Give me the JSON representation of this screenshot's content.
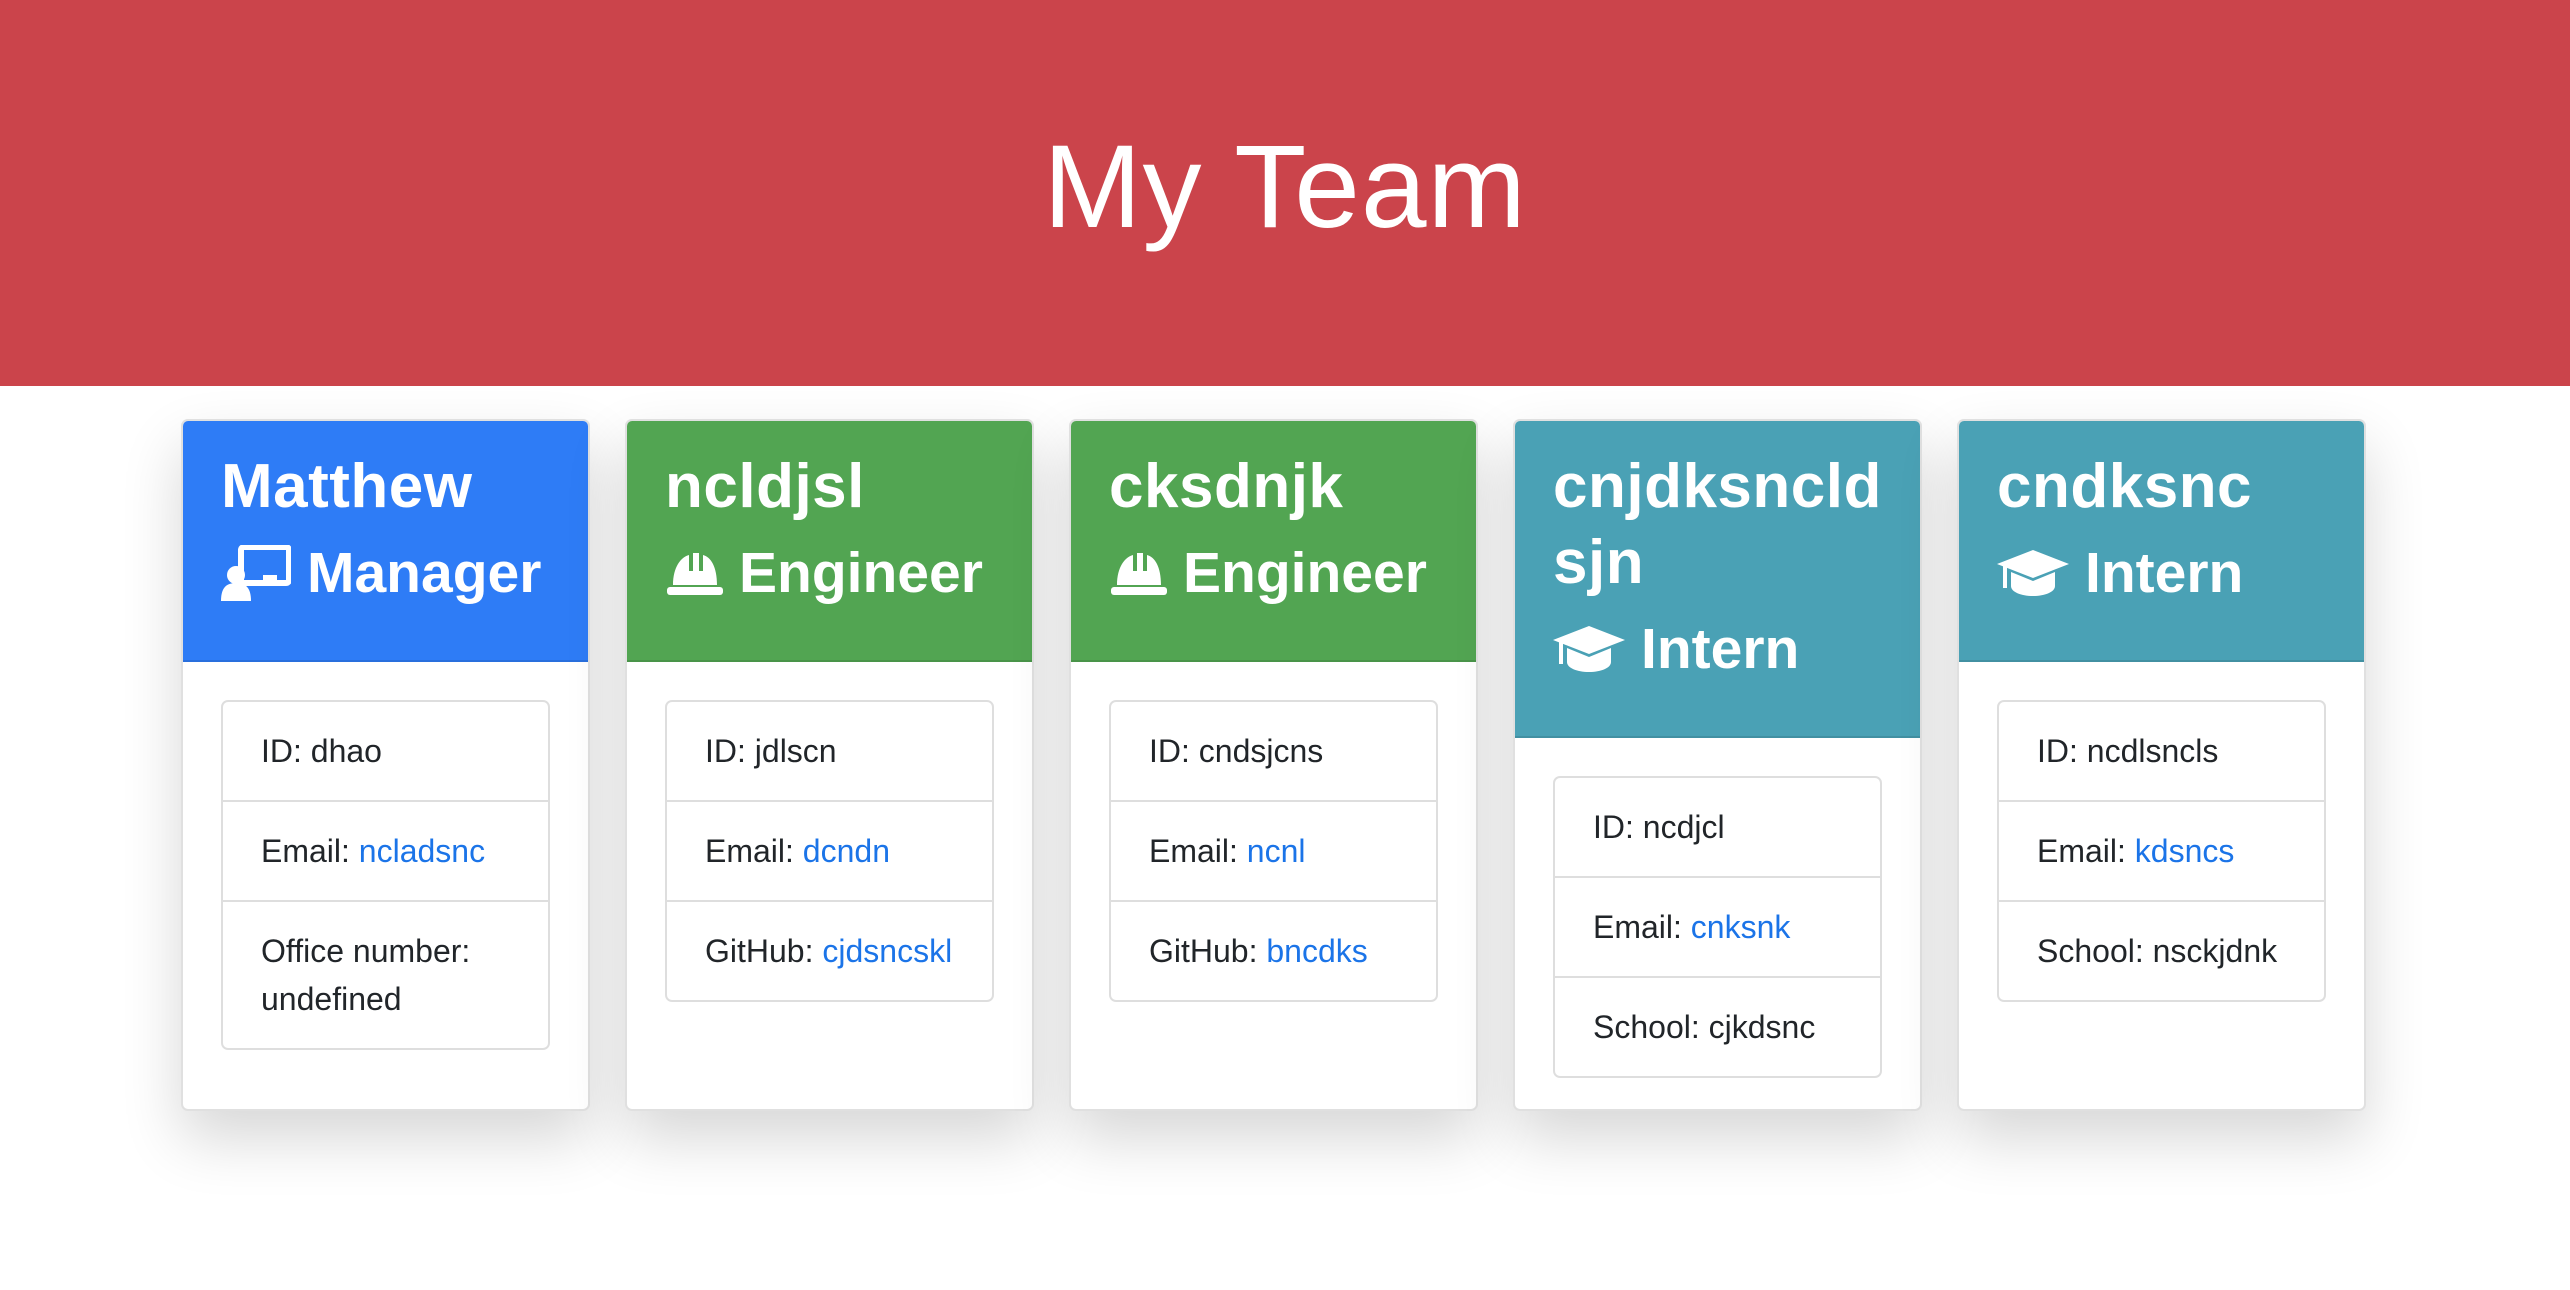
{
  "header": {
    "title": "My Team",
    "background": "#cb444b"
  },
  "employees": [
    {
      "name": "Matthew",
      "role": "Manager",
      "icon": "manager-icon",
      "color": "#2e7cf6",
      "id_label": "ID: ",
      "id": "dhao",
      "email_label": "Email: ",
      "email": "ncladsnc",
      "extra_label": "Office number: ",
      "extra_value": "undefined"
    },
    {
      "name": "ncldjsl",
      "role": "Engineer",
      "icon": "hard-hat-icon",
      "color": "#52a552",
      "id_label": "ID: ",
      "id": "jdlscn",
      "email_label": "Email: ",
      "email": "dcndn",
      "extra_label": "GitHub: ",
      "extra_value": "cjdsncskl"
    },
    {
      "name": "cksdnjk",
      "role": "Engineer",
      "icon": "hard-hat-icon",
      "color": "#52a552",
      "id_label": "ID: ",
      "id": "cndsjcns",
      "email_label": "Email: ",
      "email": "ncnl",
      "extra_label": "GitHub: ",
      "extra_value": "bncdks"
    },
    {
      "name": "cnjdksncldsjn",
      "role": "Intern",
      "icon": "graduation-cap-icon",
      "color": "#4aa1b5",
      "id_label": "ID: ",
      "id": "ncdjcl",
      "email_label": "Email: ",
      "email": "cnksnk",
      "extra_label": "School: ",
      "extra_value": "cjkdsnc"
    },
    {
      "name": "cndksnc",
      "role": "Intern",
      "icon": "graduation-cap-icon",
      "color": "#4aa1b5",
      "id_label": "ID: ",
      "id": "ncdlsncls",
      "email_label": "Email: ",
      "email": "kdsncs",
      "extra_label": "School: ",
      "extra_value": "nsckjdnk"
    }
  ]
}
